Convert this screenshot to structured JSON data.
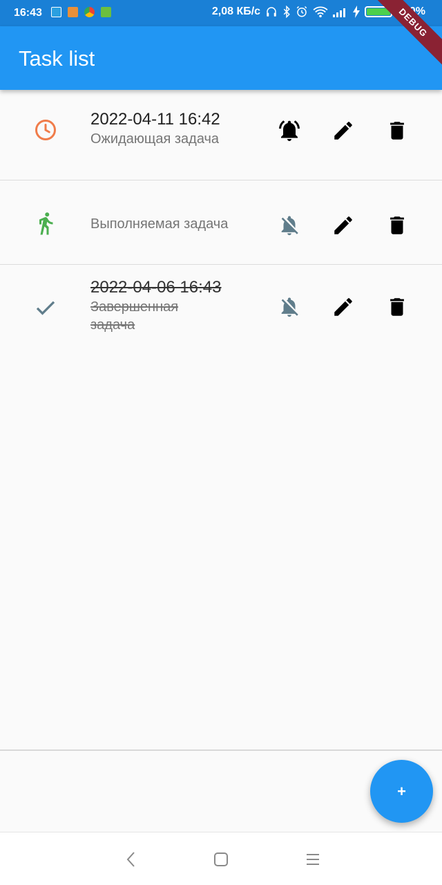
{
  "status_bar": {
    "time": "16:43",
    "network_speed": "2,08 КБ/с",
    "battery": "100%",
    "icons": [
      "headphones-icon",
      "bluetooth-icon",
      "alarm-icon",
      "wifi-icon",
      "signal-icon",
      "charging-icon",
      "battery-icon"
    ]
  },
  "app_bar": {
    "title": "Task list"
  },
  "debug_banner": "DEBUG",
  "tasks": [
    {
      "status_icon": "clock-icon",
      "date": "2022-04-11 16:42",
      "name": "Ожидающая задача",
      "notification_icon": "bell-ringing-icon",
      "status_color": "#f07c4a"
    },
    {
      "status_icon": "running-person-icon",
      "date": "",
      "name": "Выполняемая задача",
      "notification_icon": "bell-off-icon",
      "status_color": "#4caf50"
    },
    {
      "status_icon": "check-icon",
      "date": "2022-04-06 16:43",
      "name": "Завершенная задача",
      "notification_icon": "bell-off-icon",
      "status_color": "#607d8b",
      "completed": true
    }
  ],
  "fab_label": "+",
  "nav_bar": [
    "back-icon",
    "home-icon",
    "menu-icon"
  ],
  "colors": {
    "primary": "#2196f3",
    "status_bar": "#1a80d6",
    "muted_icon": "#607d8b"
  }
}
